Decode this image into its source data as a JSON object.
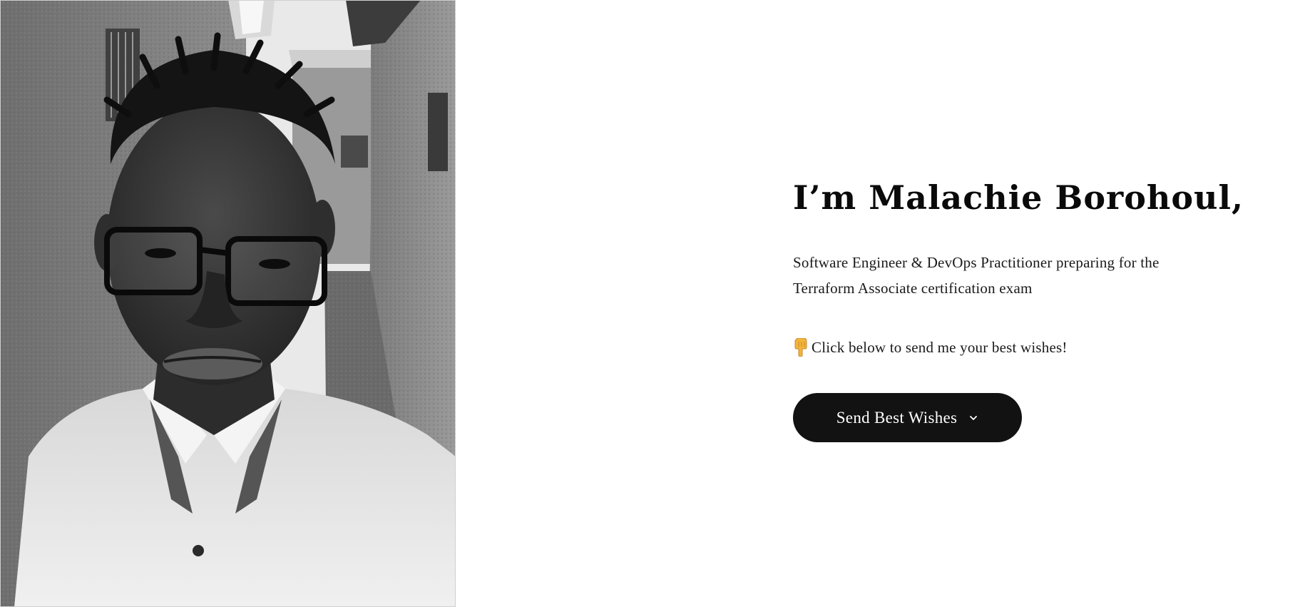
{
  "profile": {
    "photo_alt": "Portrait photo",
    "name_heading": "I’m Malachie Borohoul,",
    "description": "Software Engineer & DevOps Practitioner preparing for the Terraform Associate certification exam",
    "cta_text": "Click below to send me your best wishes!",
    "cta_icon": "pointing-down-hand-icon"
  },
  "actions": {
    "send_button_label": "Send Best Wishes",
    "send_button_icon": "chevron-down-icon"
  },
  "colors": {
    "background": "#ffffff",
    "text": "#111111",
    "button_bg": "#121212",
    "button_text": "#ffffff",
    "emoji_hand": "#f2b53a"
  }
}
